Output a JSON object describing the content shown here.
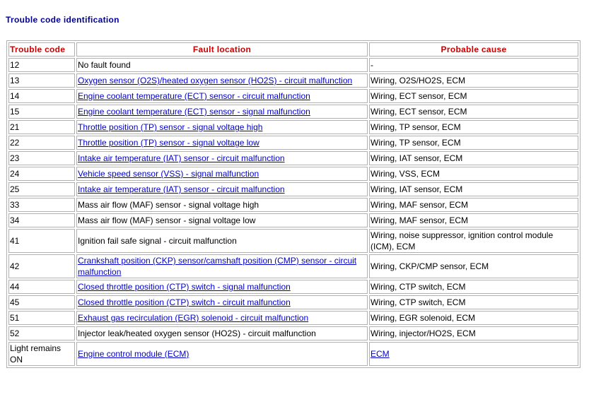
{
  "title": "Trouble code identification",
  "columns": [
    "Trouble code",
    "Fault location",
    "Probable cause"
  ],
  "rows": [
    {
      "code": "12",
      "location": "No fault found",
      "location_link": false,
      "cause": "-",
      "cause_link": false
    },
    {
      "code": "13",
      "location": "Oxygen sensor (O2S)/heated oxygen sensor (HO2S) - circuit malfunction",
      "location_link": true,
      "cause": "Wiring, O2S/HO2S, ECM",
      "cause_link": false
    },
    {
      "code": "14",
      "location": "Engine coolant temperature (ECT) sensor - circuit malfunction",
      "location_link": true,
      "cause": "Wiring, ECT sensor, ECM",
      "cause_link": false
    },
    {
      "code": "15",
      "location": "Engine coolant temperature (ECT) sensor - signal malfunction",
      "location_link": true,
      "cause": "Wiring, ECT sensor, ECM",
      "cause_link": false
    },
    {
      "code": "21",
      "location": "Throttle position (TP) sensor - signal voltage high",
      "location_link": true,
      "cause": "Wiring, TP sensor, ECM",
      "cause_link": false
    },
    {
      "code": "22",
      "location": "Throttle position (TP) sensor - signal voltage low",
      "location_link": true,
      "cause": "Wiring, TP sensor, ECM",
      "cause_link": false
    },
    {
      "code": "23",
      "location": "Intake air temperature (IAT) sensor - circuit malfunction",
      "location_link": true,
      "cause": "Wiring, IAT sensor, ECM",
      "cause_link": false
    },
    {
      "code": "24",
      "location": "Vehicle speed sensor (VSS) - signal malfunction",
      "location_link": true,
      "cause": "Wiring, VSS, ECM",
      "cause_link": false
    },
    {
      "code": "25",
      "location": "Intake air temperature (IAT) sensor - circuit malfunction",
      "location_link": true,
      "cause": "Wiring, IAT sensor, ECM",
      "cause_link": false
    },
    {
      "code": "33",
      "location": "Mass air flow (MAF) sensor - signal voltage high",
      "location_link": false,
      "cause": "Wiring, MAF sensor, ECM",
      "cause_link": false
    },
    {
      "code": "34",
      "location": "Mass air flow (MAF) sensor - signal voltage low",
      "location_link": false,
      "cause": "Wiring, MAF sensor, ECM",
      "cause_link": false
    },
    {
      "code": "41",
      "location": "Ignition fail safe signal - circuit malfunction",
      "location_link": false,
      "cause": "Wiring, noise suppressor, ignition control module (ICM), ECM",
      "cause_link": false
    },
    {
      "code": "42",
      "location": "Crankshaft position (CKP) sensor/camshaft position (CMP) sensor - circuit malfunction",
      "location_link": true,
      "cause": "Wiring, CKP/CMP sensor, ECM",
      "cause_link": false
    },
    {
      "code": "44",
      "location": "Closed throttle position (CTP) switch - signal malfunction",
      "location_link": true,
      "cause": "Wiring, CTP switch, ECM",
      "cause_link": false
    },
    {
      "code": "45",
      "location": "Closed throttle position (CTP) switch - circuit malfunction",
      "location_link": true,
      "cause": "Wiring, CTP switch, ECM",
      "cause_link": false
    },
    {
      "code": "51",
      "location": "Exhaust gas recirculation (EGR) solenoid - circuit malfunction",
      "location_link": true,
      "cause": "Wiring, EGR solenoid, ECM",
      "cause_link": false
    },
    {
      "code": "52",
      "location": "Injector leak/heated oxygen sensor (HO2S) - circuit malfunction",
      "location_link": false,
      "cause": "Wiring, injector/HO2S, ECM",
      "cause_link": false
    },
    {
      "code": "Light remains ON",
      "location": "Engine control module (ECM)",
      "location_link": true,
      "cause": "ECM",
      "cause_link": true
    }
  ]
}
